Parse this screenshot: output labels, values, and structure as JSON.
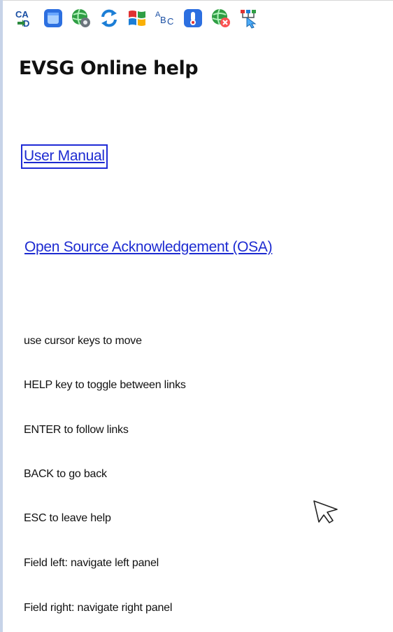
{
  "toolbar": {
    "icons": [
      "cad-arrow-icon",
      "window-icon",
      "globe-gear-icon",
      "refresh-icon",
      "windows-flag-icon",
      "abc-text-icon",
      "thermometer-info-icon",
      "globe-cancel-icon",
      "tree-pointer-icon"
    ]
  },
  "page": {
    "title": "EVSG Online help"
  },
  "links": {
    "user_manual": "User Manual",
    "osa": "Open Source Acknowledgement (OSA)"
  },
  "help_lines": [
    "use cursor keys to move",
    "HELP key to toggle between links",
    "ENTER to follow links",
    "BACK to go back",
    "ESC to leave help",
    "Field left: navigate left panel",
    "Field right: navigate right panel"
  ],
  "colors": {
    "link": "#1d2bd1",
    "focus_border": "#1f2bd6"
  }
}
